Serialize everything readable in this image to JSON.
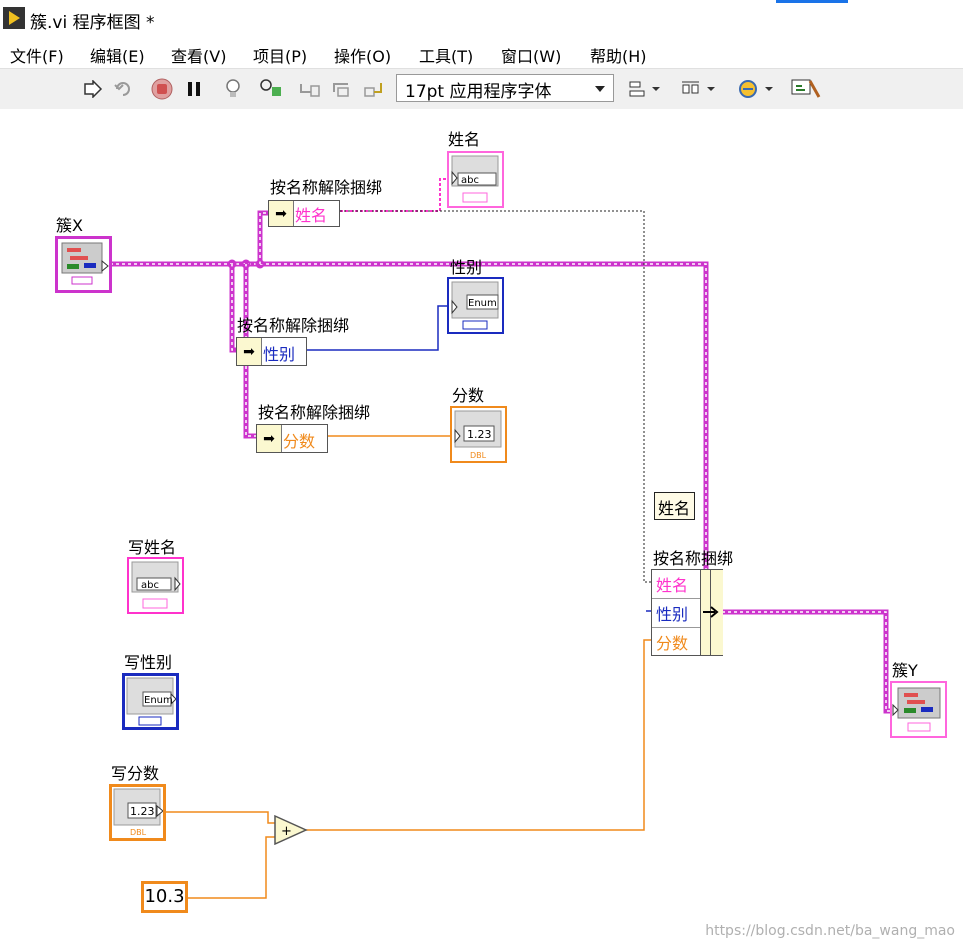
{
  "window": {
    "title": "簇.vi 程序框图 *"
  },
  "menu": [
    "文件(F)",
    "编辑(E)",
    "查看(V)",
    "项目(P)",
    "操作(O)",
    "工具(T)",
    "窗口(W)",
    "帮助(H)"
  ],
  "toolbar": {
    "font_select": "17pt 应用程序字体",
    "icons": [
      "run-arrow-icon",
      "retain-wire-icon",
      "abort-icon",
      "pause-icon",
      "highlight-bulb-icon",
      "probe-icon",
      "step-into-icon",
      "step-over-icon",
      "step-out-icon",
      "align-icon",
      "distribute-icon",
      "reorder-icon",
      "cleanup-icon"
    ]
  },
  "diagram": {
    "cluster_in": "簇X",
    "cluster_out": "簇Y",
    "unbundle_label": "按名称解除捆绑",
    "bundle_label": "按名称捆绑",
    "fields": {
      "name": "姓名",
      "gender": "性别",
      "score": "分数"
    },
    "indicators": {
      "name": "姓名",
      "gender": "性别",
      "score": "分数"
    },
    "controls": {
      "write_name": "写姓名",
      "write_gender": "写性别",
      "write_score": "写分数"
    },
    "constant_name": "姓名",
    "numeric_constant": "10.3",
    "glyphs": {
      "abc": "abc",
      "enum": "Enum",
      "num": "1.23",
      "dbl": "DBL",
      "add": "+"
    },
    "colors": {
      "string": "#ff33cc",
      "enum": "#1a2bbf",
      "dbl": "#f08a1c",
      "cluster": "#cc33cc"
    }
  },
  "watermark": "https://blog.csdn.net/ba_wang_mao"
}
